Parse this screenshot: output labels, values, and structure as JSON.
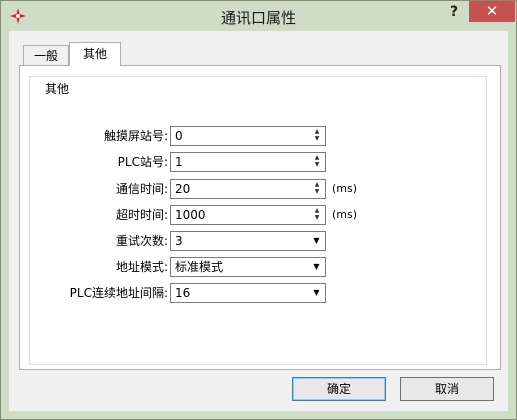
{
  "window": {
    "title": "通讯口属性",
    "help_label": "?",
    "close_label": "✕",
    "app_icon": "red-star-icon",
    "close_color": "#c75050"
  },
  "tabs": [
    {
      "label": "一般"
    },
    {
      "label": "其他",
      "selected": true
    }
  ],
  "group": {
    "title": "其他"
  },
  "fields": [
    {
      "label": "触摸屏站号:",
      "value": "0",
      "control": "spinner"
    },
    {
      "label": "PLC站号:",
      "value": "1",
      "control": "spinner"
    },
    {
      "label": "通信时间:",
      "value": "20",
      "control": "spinner",
      "unit": "(ms)"
    },
    {
      "label": "超时时间:",
      "value": "1000",
      "control": "spinner",
      "unit": "(ms)"
    },
    {
      "label": "重试次数:",
      "value": "3",
      "control": "dropdown"
    },
    {
      "label": "地址模式:",
      "value": "标准模式",
      "control": "dropdown"
    },
    {
      "label": "PLC连续地址间隔:",
      "value": "16",
      "control": "dropdown"
    }
  ],
  "buttons": {
    "ok": "确定",
    "cancel": "取消"
  }
}
